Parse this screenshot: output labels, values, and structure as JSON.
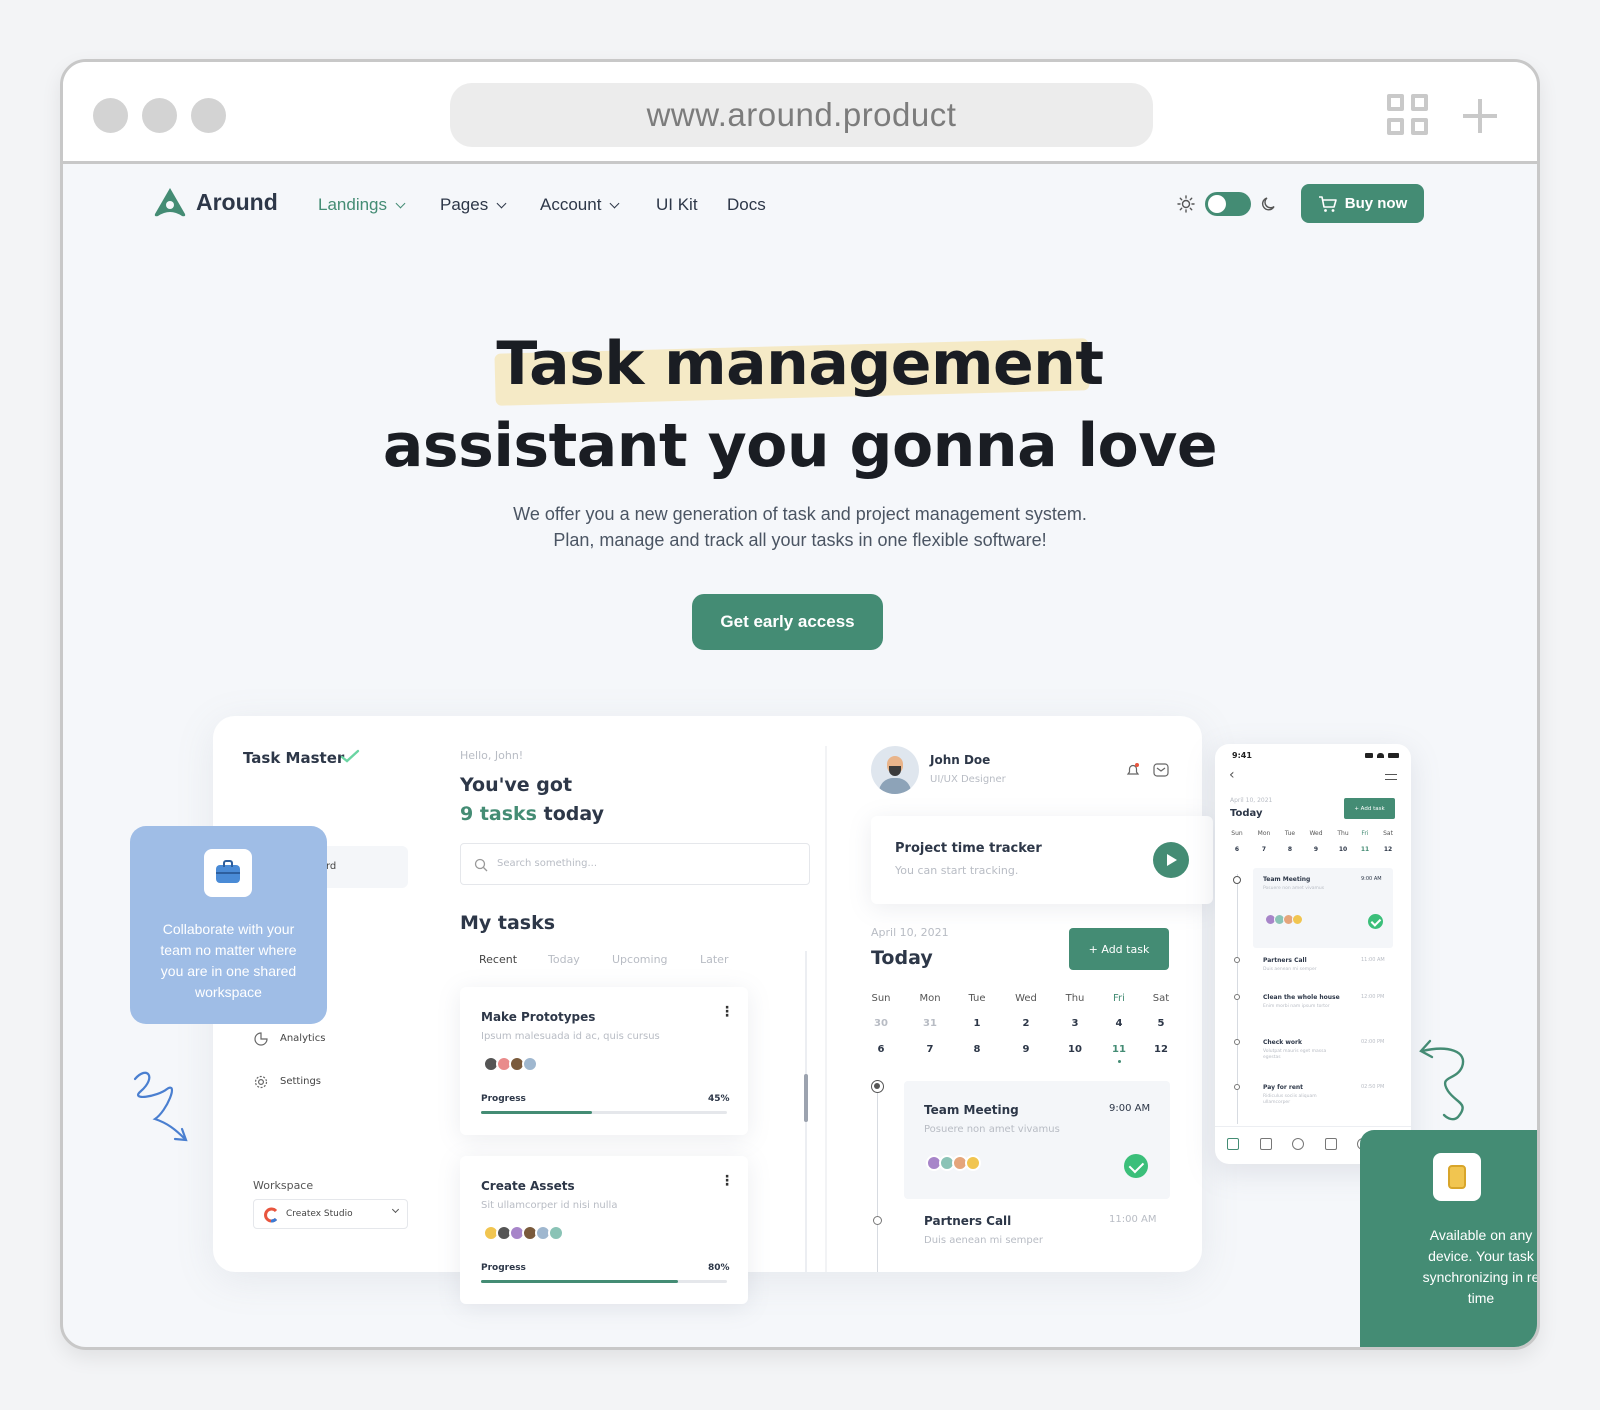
{
  "browser": {
    "url": "www.around.product"
  },
  "nav": {
    "brand": "Around",
    "items": [
      {
        "label": "Landings"
      },
      {
        "label": "Pages"
      },
      {
        "label": "Account"
      },
      {
        "label": "UI Kit"
      },
      {
        "label": "Docs"
      }
    ],
    "buy_label": "Buy now",
    "accent": "#448c74"
  },
  "hero": {
    "title_line1": "Task management",
    "title_line2": "assistant you gonna love",
    "subtitle_line1": "We offer you a new generation of task and project management system.",
    "subtitle_line2": "Plan, manage and track all your tasks in one flexible software!",
    "cta_label": "Get early access"
  },
  "dashboard": {
    "app_name": "Task Master",
    "greeting": "Hello, John!",
    "headline_line1": "You've got",
    "headline_count": "9 tasks",
    "headline_suffix": "today",
    "search_placeholder": "Search something...",
    "sidebar_partial": "rd",
    "sidebar_items": [
      {
        "label": "Analytics"
      },
      {
        "label": "Settings"
      }
    ],
    "workspace_label": "Workspace",
    "workspace_value": "Createx Studio",
    "my_tasks_title": "My tasks",
    "task_tabs": [
      "Recent",
      "Today",
      "Upcoming",
      "Later"
    ],
    "tasks": [
      {
        "title": "Make Prototypes",
        "desc": "Ipsum malesuada id ac, quis cursus",
        "progress_label": "Progress",
        "progress_text": "45%",
        "progress": 0.45
      },
      {
        "title": "Create Assets",
        "desc": "Sit ullamcorper id nisi nulla",
        "progress_label": "Progress",
        "progress_text": "80%",
        "progress": 0.8
      }
    ],
    "user": {
      "name": "John Doe",
      "role": "UI/UX Designer"
    },
    "tracker": {
      "title": "Project time tracker",
      "subtitle": "You can start tracking."
    },
    "calendar": {
      "date": "April 10, 2021",
      "title": "Today",
      "add_task_label": "+ Add task",
      "days": [
        "Sun",
        "Mon",
        "Tue",
        "Wed",
        "Thu",
        "Fri",
        "Sat"
      ],
      "week1": [
        "30",
        "31",
        "1",
        "2",
        "3",
        "4",
        "5"
      ],
      "week2": [
        "6",
        "7",
        "8",
        "9",
        "10",
        "11",
        "12"
      ]
    },
    "events": [
      {
        "title": "Team Meeting",
        "desc": "Posuere non amet vivamus",
        "time": "9:00 AM"
      },
      {
        "title": "Partners Call",
        "desc": "Duis aenean mi semper",
        "time": "11:00 AM"
      }
    ]
  },
  "blue_card": {
    "text_lines": [
      "Collaborate with your",
      "team no matter where",
      "you are in one shared",
      "workspace"
    ]
  },
  "green_card": {
    "text_lines": [
      "Available on any",
      "device. Your task",
      "synchronizing in re",
      "time"
    ]
  },
  "phone": {
    "time": "9:41",
    "date": "April 10, 2021",
    "title": "Today",
    "add_task_label": "+ Add task",
    "days": [
      "Sun",
      "Mon",
      "Tue",
      "Wed",
      "Thu",
      "Fri",
      "Sat"
    ],
    "dates": [
      "6",
      "7",
      "8",
      "9",
      "10",
      "11",
      "12"
    ],
    "events": [
      {
        "title": "Team Meeting",
        "desc": "Posuere non amet vivamus",
        "time": "9:00 AM"
      },
      {
        "title": "Partners Call",
        "desc": "Duis aenean mi semper",
        "time": "11:00 AM"
      },
      {
        "title": "Clean the whole house",
        "desc": "Enim morbi nam ipsum tortor",
        "time": "12:00 PM"
      },
      {
        "title": "Check work",
        "desc": "Volutpat mauris eget massa egestas",
        "time": "02:00 PM"
      },
      {
        "title": "Pay for rent",
        "desc": "Ridiculus sociis aliquam ullamcorper",
        "time": "02:50 PM"
      }
    ]
  }
}
